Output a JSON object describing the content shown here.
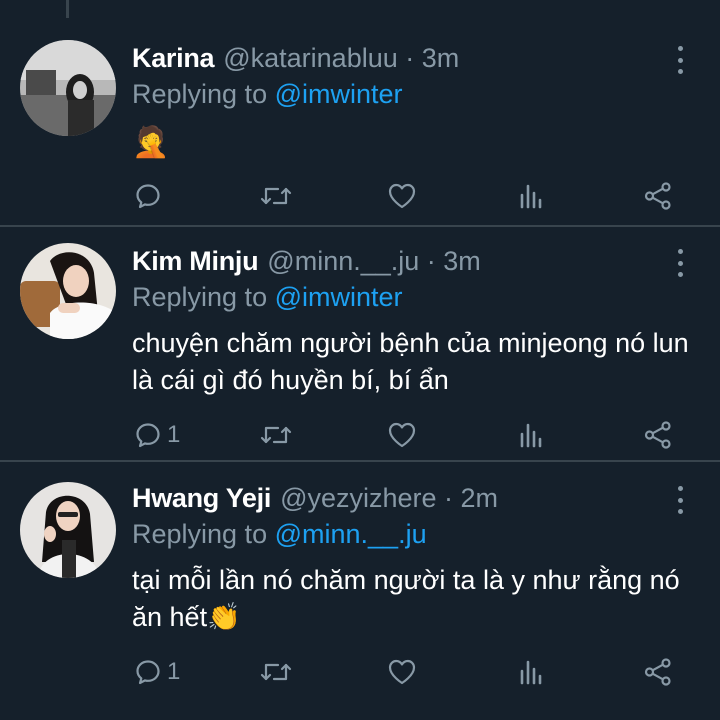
{
  "tweets": [
    {
      "name": "Karina",
      "handle": "@katarinabluu · 3m",
      "reply_prefix": "Replying to",
      "reply_to": "@imwinter",
      "text": "🤦",
      "reply_count": ""
    },
    {
      "name": "Kim Minju",
      "handle": "@minn.__.ju · 3m",
      "reply_prefix": "Replying to",
      "reply_to": "@imwinter",
      "text": "chuyện chăm người bệnh của minjeong nó lun là cái gì đó huyền bí, bí ẩn",
      "reply_count": "1"
    },
    {
      "name": "Hwang Yeji",
      "handle": "@yezyizhere · 2m",
      "reply_prefix": "Replying to",
      "reply_to": "@minn.__.ju",
      "text": "tại mỗi lần nó chăm người ta là y như rằng nó ăn hết👏",
      "reply_count": "1"
    }
  ],
  "colors": {
    "background": "#15202b",
    "secondary_text": "#8899a6",
    "link": "#1da1f2",
    "divider": "#38444d"
  },
  "icons": [
    "reply-icon",
    "retweet-icon",
    "like-icon",
    "analytics-icon",
    "share-icon",
    "more-icon"
  ]
}
